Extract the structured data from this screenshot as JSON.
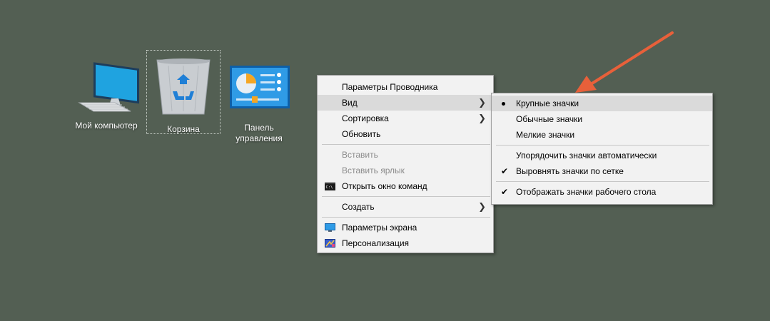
{
  "desktop": {
    "icons": [
      {
        "label": "Мой компьютер"
      },
      {
        "label": "Корзина"
      },
      {
        "label": "Панель\nуправления"
      }
    ]
  },
  "context_menu": {
    "items": [
      {
        "label": "Параметры Проводника"
      },
      {
        "label": "Вид"
      },
      {
        "label": "Сортировка"
      },
      {
        "label": "Обновить"
      },
      {
        "label": "Вставить"
      },
      {
        "label": "Вставить ярлык"
      },
      {
        "label": "Открыть окно команд"
      },
      {
        "label": "Создать"
      },
      {
        "label": "Параметры экрана"
      },
      {
        "label": "Персонализация"
      }
    ]
  },
  "view_submenu": {
    "items": [
      {
        "label": "Крупные значки"
      },
      {
        "label": "Обычные значки"
      },
      {
        "label": "Мелкие значки"
      },
      {
        "label": "Упорядочить значки автоматически"
      },
      {
        "label": "Выровнять значки по сетке"
      },
      {
        "label": "Отображать значки рабочего стола"
      }
    ]
  },
  "colors": {
    "desktop_bg": "#535f53",
    "annotation_arrow": "#e8603a",
    "menu_bg": "#f2f2f2",
    "menu_hover": "#dadada"
  }
}
